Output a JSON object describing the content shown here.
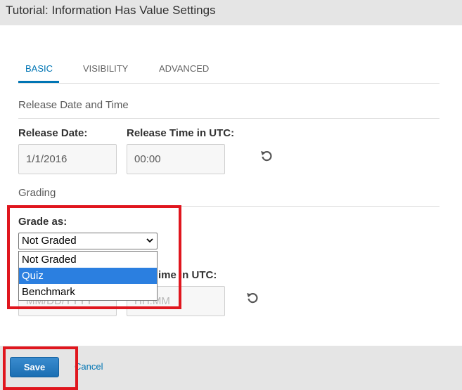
{
  "window": {
    "title": "Tutorial: Information Has Value Settings"
  },
  "tabs": [
    {
      "label": "BASIC",
      "active": true
    },
    {
      "label": "VISIBILITY",
      "active": false
    },
    {
      "label": "ADVANCED",
      "active": false
    }
  ],
  "release": {
    "section_title": "Release Date and Time",
    "date_label": "Release Date:",
    "time_label": "Release Time in UTC:",
    "date_value": "1/1/2016",
    "time_value": "00:00",
    "reset_icon": "undo-icon"
  },
  "grading": {
    "section_title": "Grading",
    "grade_label": "Grade as:",
    "selected": "Not Graded",
    "options": [
      "Not Graded",
      "Quiz",
      "Benchmark"
    ],
    "highlighted_option": "Quiz"
  },
  "due": {
    "time_label_visible_part": "ime in UTC:",
    "date_placeholder": "MM/DD/YYYY",
    "time_placeholder": "HH:MM",
    "reset_icon": "undo-icon"
  },
  "footer": {
    "save_label": "Save",
    "cancel_label": "Cancel"
  },
  "colors": {
    "accent": "#0075b4",
    "highlight_box": "#e0161e",
    "save_button": "#1b6eb2"
  }
}
